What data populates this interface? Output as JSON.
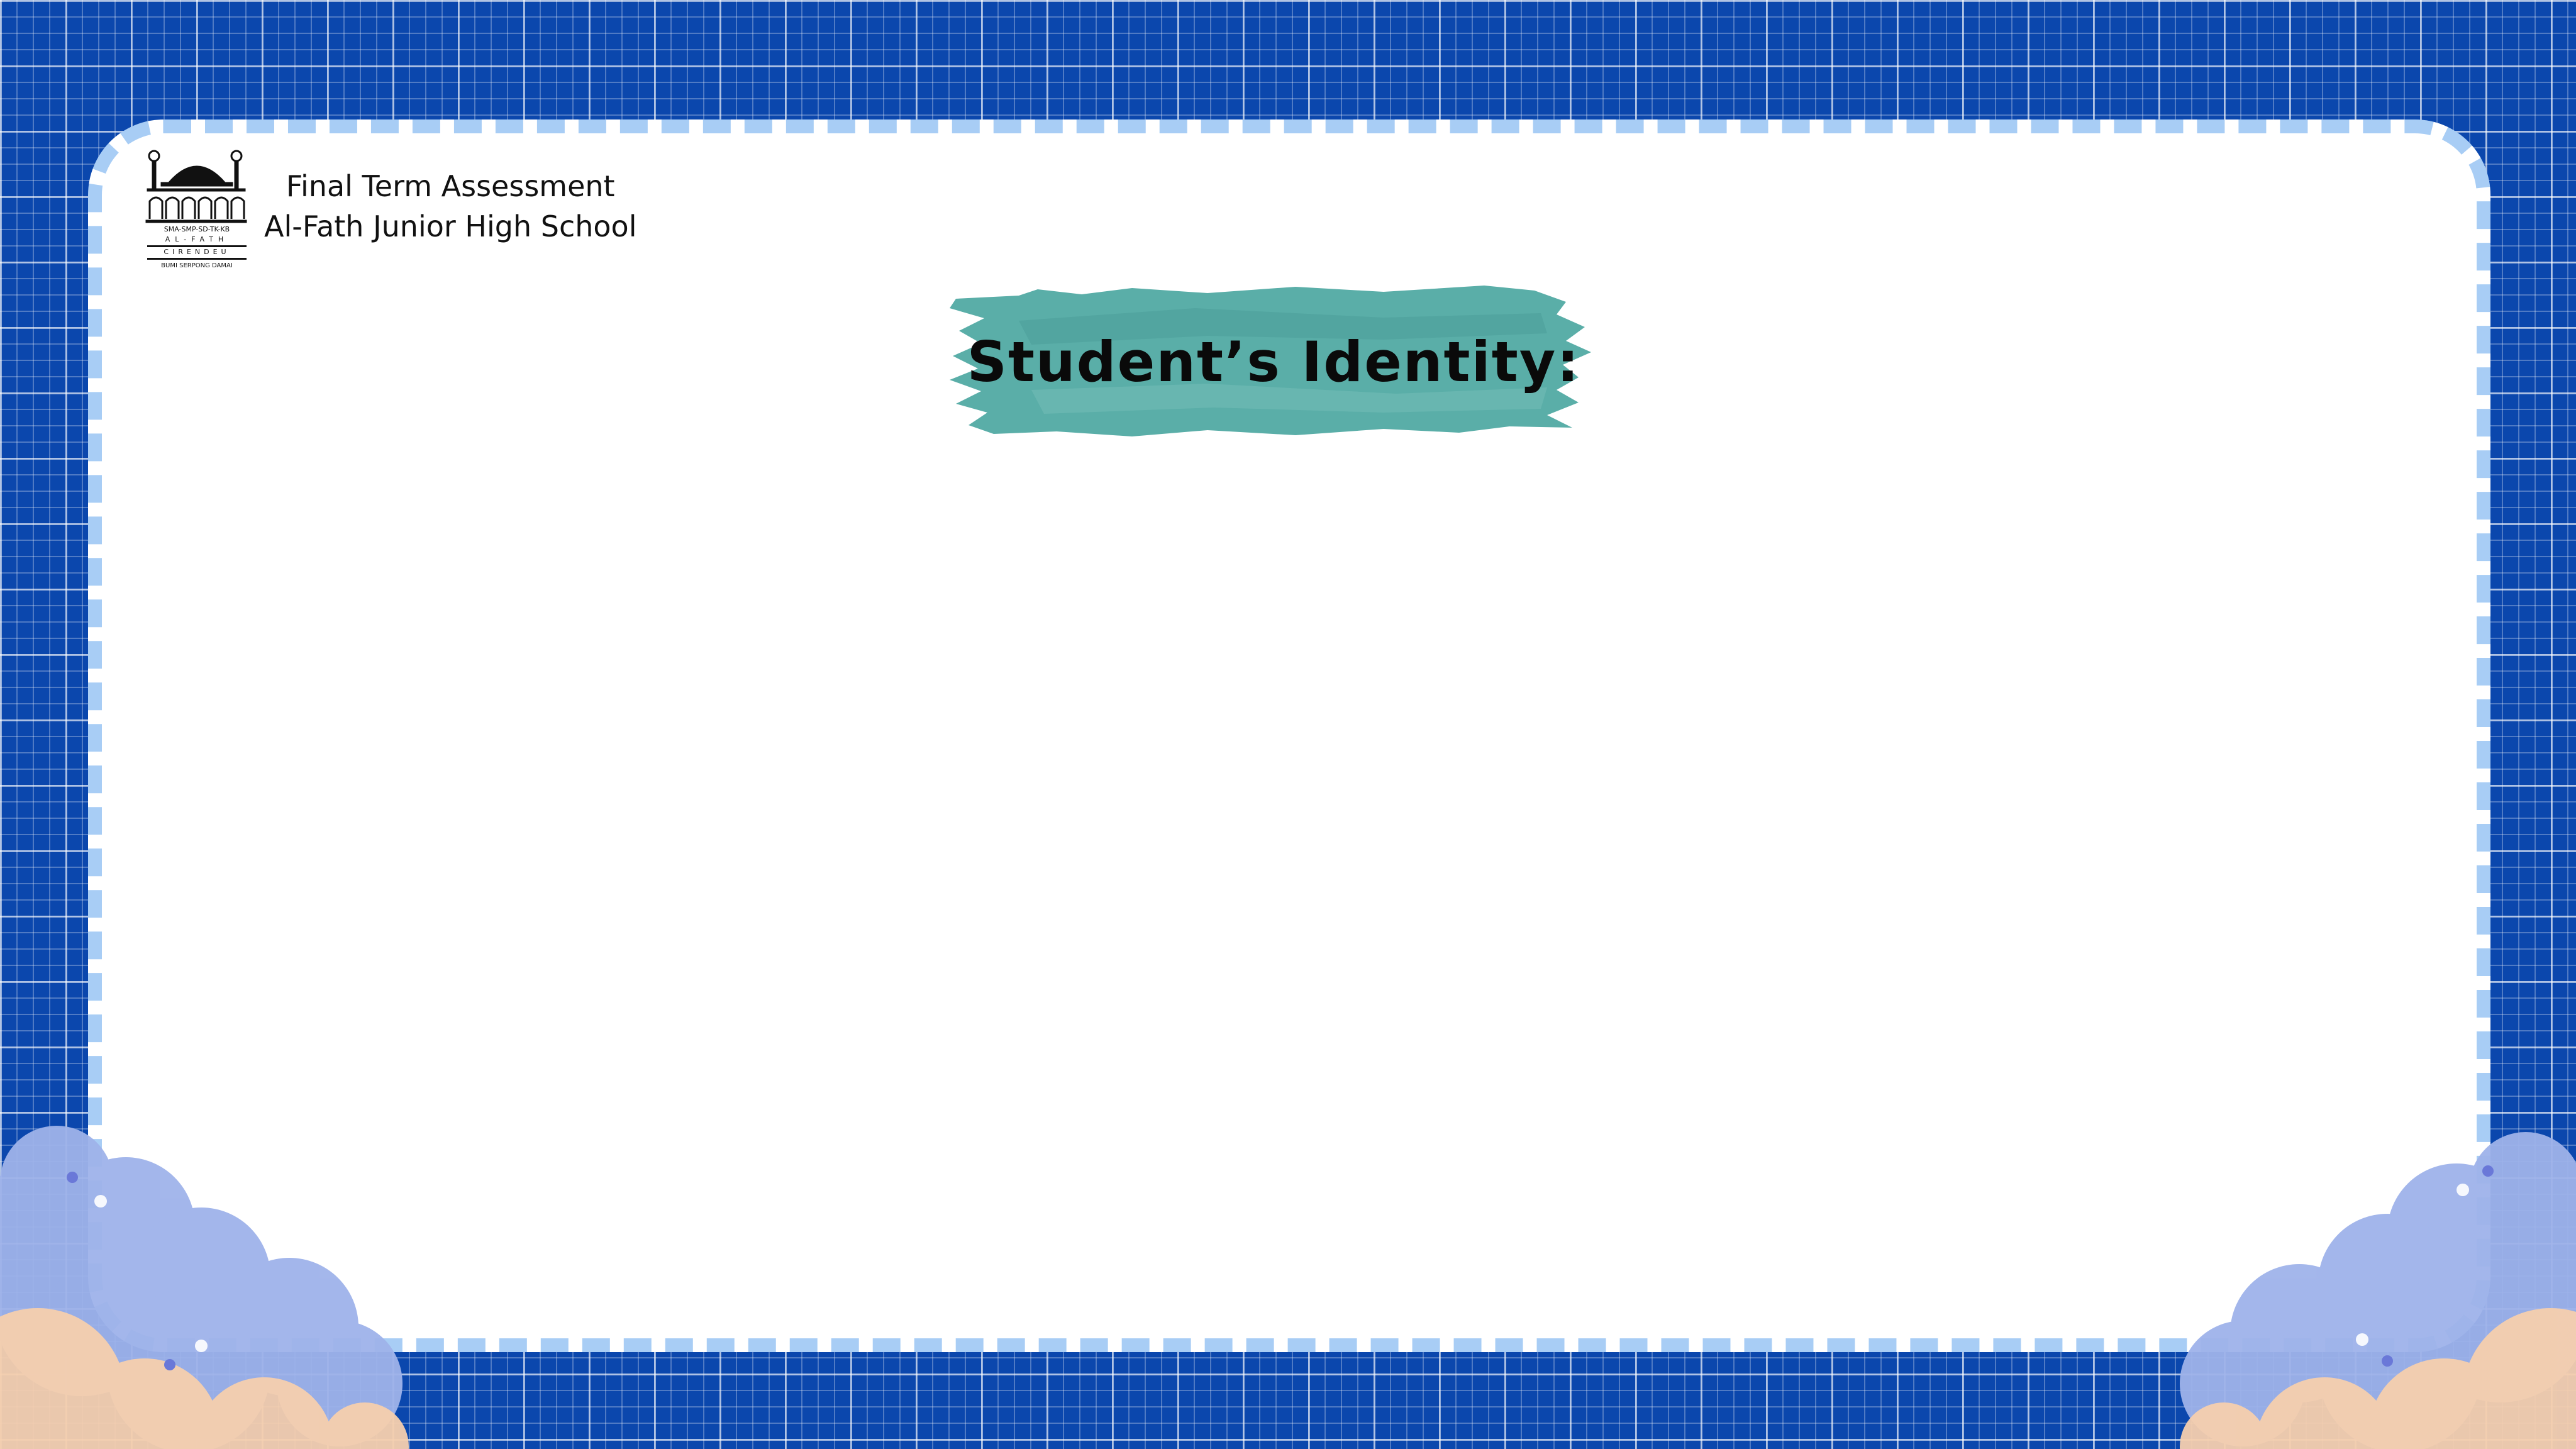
{
  "header": {
    "line1": "Final Term Assessment",
    "line2": "Al-Fath Junior High School"
  },
  "logo": {
    "icon": "mosque-icon",
    "text_top": "SMA-SMP-SD-TK-KB",
    "text_name": "AL-FATH",
    "text_place": "CIRENDEU",
    "text_bottom": "BUMI SERPONG DAMAI"
  },
  "title": {
    "text": "Student’s Identity:"
  },
  "colors": {
    "background": "#0b47ad",
    "card": "#ffffff",
    "card_border": "#a8cdf5",
    "brush": "#5aaea8",
    "cloud_blue": "#9fb3ea",
    "cloud_peach": "#f6cfae"
  }
}
